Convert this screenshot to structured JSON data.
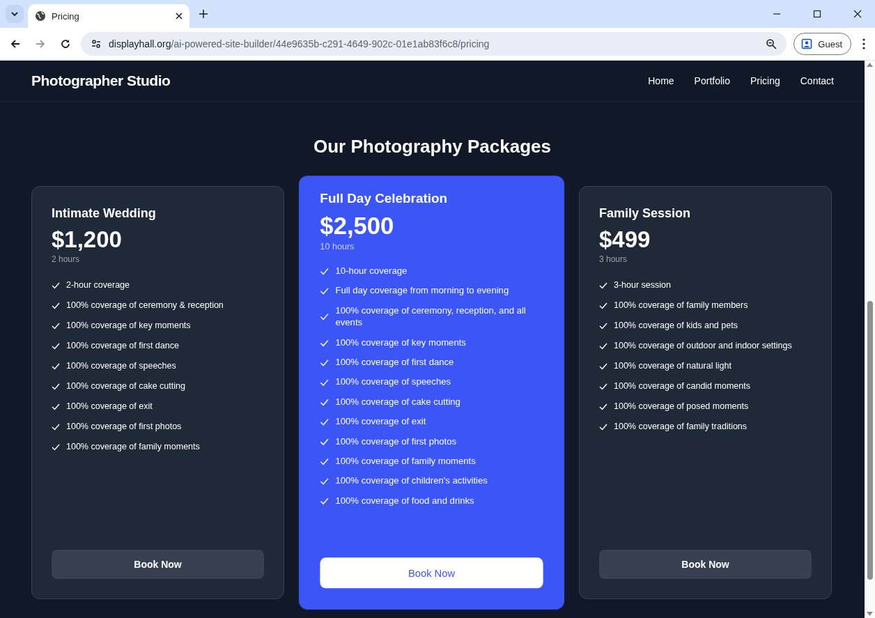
{
  "browser": {
    "tab": {
      "title": "Pricing",
      "selected": true
    },
    "url_host": "displayhall.org",
    "url_path": "/ai-powered-site-builder/44e9635b-c291-4649-902c-01e1ab83f6c8/pricing",
    "profile": "Guest"
  },
  "site": {
    "logo": "Photographer Studio",
    "nav": [
      {
        "label": "Home"
      },
      {
        "label": "Portfolio"
      },
      {
        "label": "Pricing"
      },
      {
        "label": "Contact"
      }
    ],
    "heading": "Our Photography Packages",
    "packages": [
      {
        "name": "Intimate Wedding",
        "price": "$1,200",
        "duration": "2 hours",
        "featured": false,
        "button": "Book Now",
        "features": [
          "2-hour coverage",
          "100% coverage of ceremony & reception",
          "100% coverage of key moments",
          "100% coverage of first dance",
          "100% coverage of speeches",
          "100% coverage of cake cutting",
          "100% coverage of exit",
          "100% coverage of first photos",
          "100% coverage of family moments"
        ]
      },
      {
        "name": "Full Day Celebration",
        "price": "$2,500",
        "duration": "10 hours",
        "featured": true,
        "button": "Book Now",
        "features": [
          "10-hour coverage",
          "Full day coverage from morning to evening",
          "100% coverage of ceremony, reception, and all events",
          "100% coverage of key moments",
          "100% coverage of first dance",
          "100% coverage of speeches",
          "100% coverage of cake cutting",
          "100% coverage of exit",
          "100% coverage of first photos",
          "100% coverage of family moments",
          "100% coverage of children's activities",
          "100% coverage of food and drinks"
        ]
      },
      {
        "name": "Family Session",
        "price": "$499",
        "duration": "3 hours",
        "featured": false,
        "button": "Book Now",
        "features": [
          "3-hour session",
          "100% coverage of family members",
          "100% coverage of kids and pets",
          "100% coverage of outdoor and indoor settings",
          "100% coverage of natural light",
          "100% coverage of candid moments",
          "100% coverage of posed moments",
          "100% coverage of family traditions"
        ]
      }
    ]
  }
}
